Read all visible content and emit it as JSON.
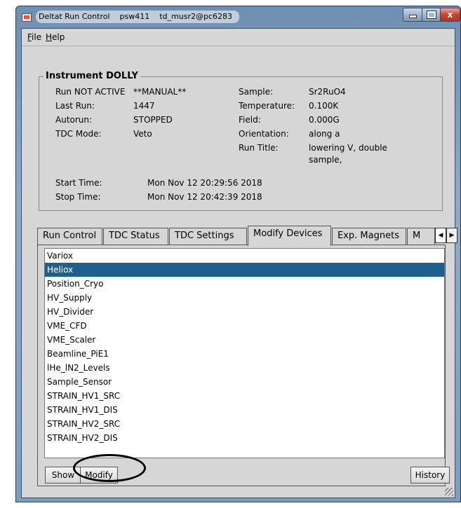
{
  "window": {
    "title_parts": [
      "Deltat Run Control",
      "psw411",
      "td_musr2@pc6283"
    ],
    "controls": {
      "minimize": "minimize",
      "maximize": "maximize",
      "close": "x"
    }
  },
  "menu": {
    "file": {
      "mnemonic": "F",
      "rest": "ile"
    },
    "help": {
      "mnemonic": "H",
      "rest": "elp"
    }
  },
  "instrument": {
    "title": "Instrument DOLLY",
    "run_status": "Run NOT ACTIVE",
    "run_mode": "**MANUAL**",
    "last_run_label": "Last Run:",
    "last_run_value": "1447",
    "autorun_label": "Autorun:",
    "autorun_value": "STOPPED",
    "tdc_mode_label": "TDC Mode:",
    "tdc_mode_value": "Veto",
    "sample_label": "Sample:",
    "sample_value": "Sr2RuO4",
    "temperature_label": "Temperature:",
    "temperature_value": "0.100K",
    "field_label": "Field:",
    "field_value": "0.000G",
    "orientation_label": "Orientation:",
    "orientation_value": "along a",
    "run_title_label": "Run Title:",
    "run_title_line1": "lowering V, double",
    "run_title_line2": "sample,",
    "start_time_label": "Start Time:",
    "start_time_value": "Mon Nov 12 20:29:56 2018",
    "stop_time_label": "Stop Time:",
    "stop_time_value": "Mon Nov 12 20:42:39 2018"
  },
  "tabs": [
    {
      "label": "Run Control"
    },
    {
      "label": "TDC Status"
    },
    {
      "label": "TDC Settings"
    },
    {
      "label": "Modify Devices"
    },
    {
      "label": "Exp. Magnets"
    },
    {
      "label": "M"
    }
  ],
  "active_tab": "Modify Devices",
  "devices": [
    "Variox",
    "Heliox",
    "Position_Cryo",
    "HV_Supply",
    "HV_Divider",
    "VME_CFD",
    "VME_Scaler",
    "Beamline_PiE1",
    "lHe_lN2_Levels",
    "Sample_Sensor",
    "STRAIN_HV1_SRC",
    "STRAIN_HV1_DIS",
    "STRAIN_HV2_SRC",
    "STRAIN_HV2_DIS"
  ],
  "selected_device": "Heliox",
  "buttons": {
    "show": "Show",
    "modify": "Modify",
    "history": "History"
  },
  "colors": {
    "selection": "#1f5f8b",
    "dialog_bg": "#d6d6d6"
  }
}
